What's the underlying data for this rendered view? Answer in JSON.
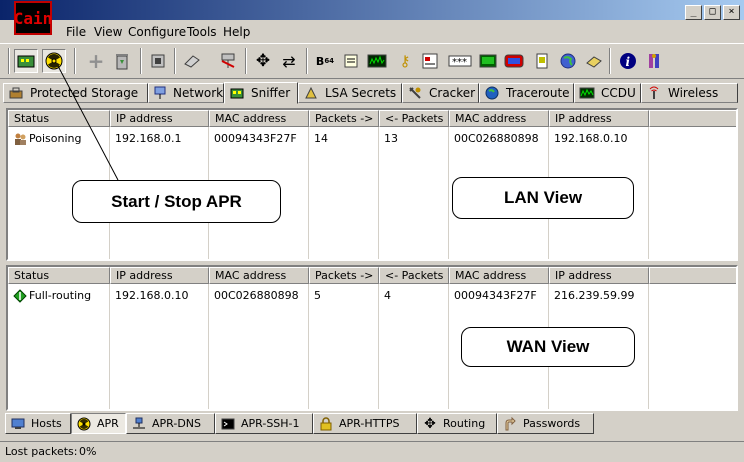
{
  "app": {
    "logo_text": "Cain"
  },
  "menu": [
    "File",
    "View",
    "Configure",
    "Tools",
    "Help"
  ],
  "window_buttons": [
    "_",
    "□",
    "×"
  ],
  "tabs": [
    {
      "label": "Protected Storage",
      "icon": "protected-storage-icon"
    },
    {
      "label": "Network",
      "icon": "network-icon"
    },
    {
      "label": "Sniffer",
      "icon": "sniffer-icon",
      "active": true
    },
    {
      "label": "LSA Secrets",
      "icon": "lsa-secrets-icon"
    },
    {
      "label": "Cracker",
      "icon": "cracker-icon"
    },
    {
      "label": "Traceroute",
      "icon": "traceroute-icon"
    },
    {
      "label": "CCDU",
      "icon": "ccdu-icon"
    },
    {
      "label": "Wireless",
      "icon": "wireless-icon"
    }
  ],
  "columns": [
    "Status",
    "IP address",
    "MAC address",
    "Packets ->",
    "<- Packets",
    "MAC address",
    "IP address"
  ],
  "lan": {
    "rows": [
      {
        "status": "Poisoning",
        "ip1": "192.168.0.1",
        "mac1": "00094343F27F",
        "out": "14",
        "in": "13",
        "mac2": "00C026880898",
        "ip2": "192.168.0.10"
      }
    ]
  },
  "wan": {
    "rows": [
      {
        "status": "Full-routing",
        "ip1": "192.168.0.10",
        "mac1": "00C026880898",
        "out": "5",
        "in": "4",
        "mac2": "00094343F27F",
        "ip2": "216.239.59.99"
      }
    ]
  },
  "callouts": {
    "start_stop": "Start / Stop APR",
    "lan": "LAN View",
    "wan": "WAN View"
  },
  "bottom_tabs": [
    {
      "label": "Hosts",
      "icon": "hosts-icon"
    },
    {
      "label": "APR",
      "icon": "apr-icon",
      "active": true
    },
    {
      "label": "APR-DNS",
      "icon": "apr-dns-icon"
    },
    {
      "label": "APR-SSH-1",
      "icon": "apr-ssh-icon"
    },
    {
      "label": "APR-HTTPS",
      "icon": "apr-https-icon"
    },
    {
      "label": "Routing",
      "icon": "routing-icon"
    },
    {
      "label": "Passwords",
      "icon": "passwords-icon"
    }
  ],
  "status": {
    "lost_packets": "Lost packets:",
    "value": "0%"
  }
}
